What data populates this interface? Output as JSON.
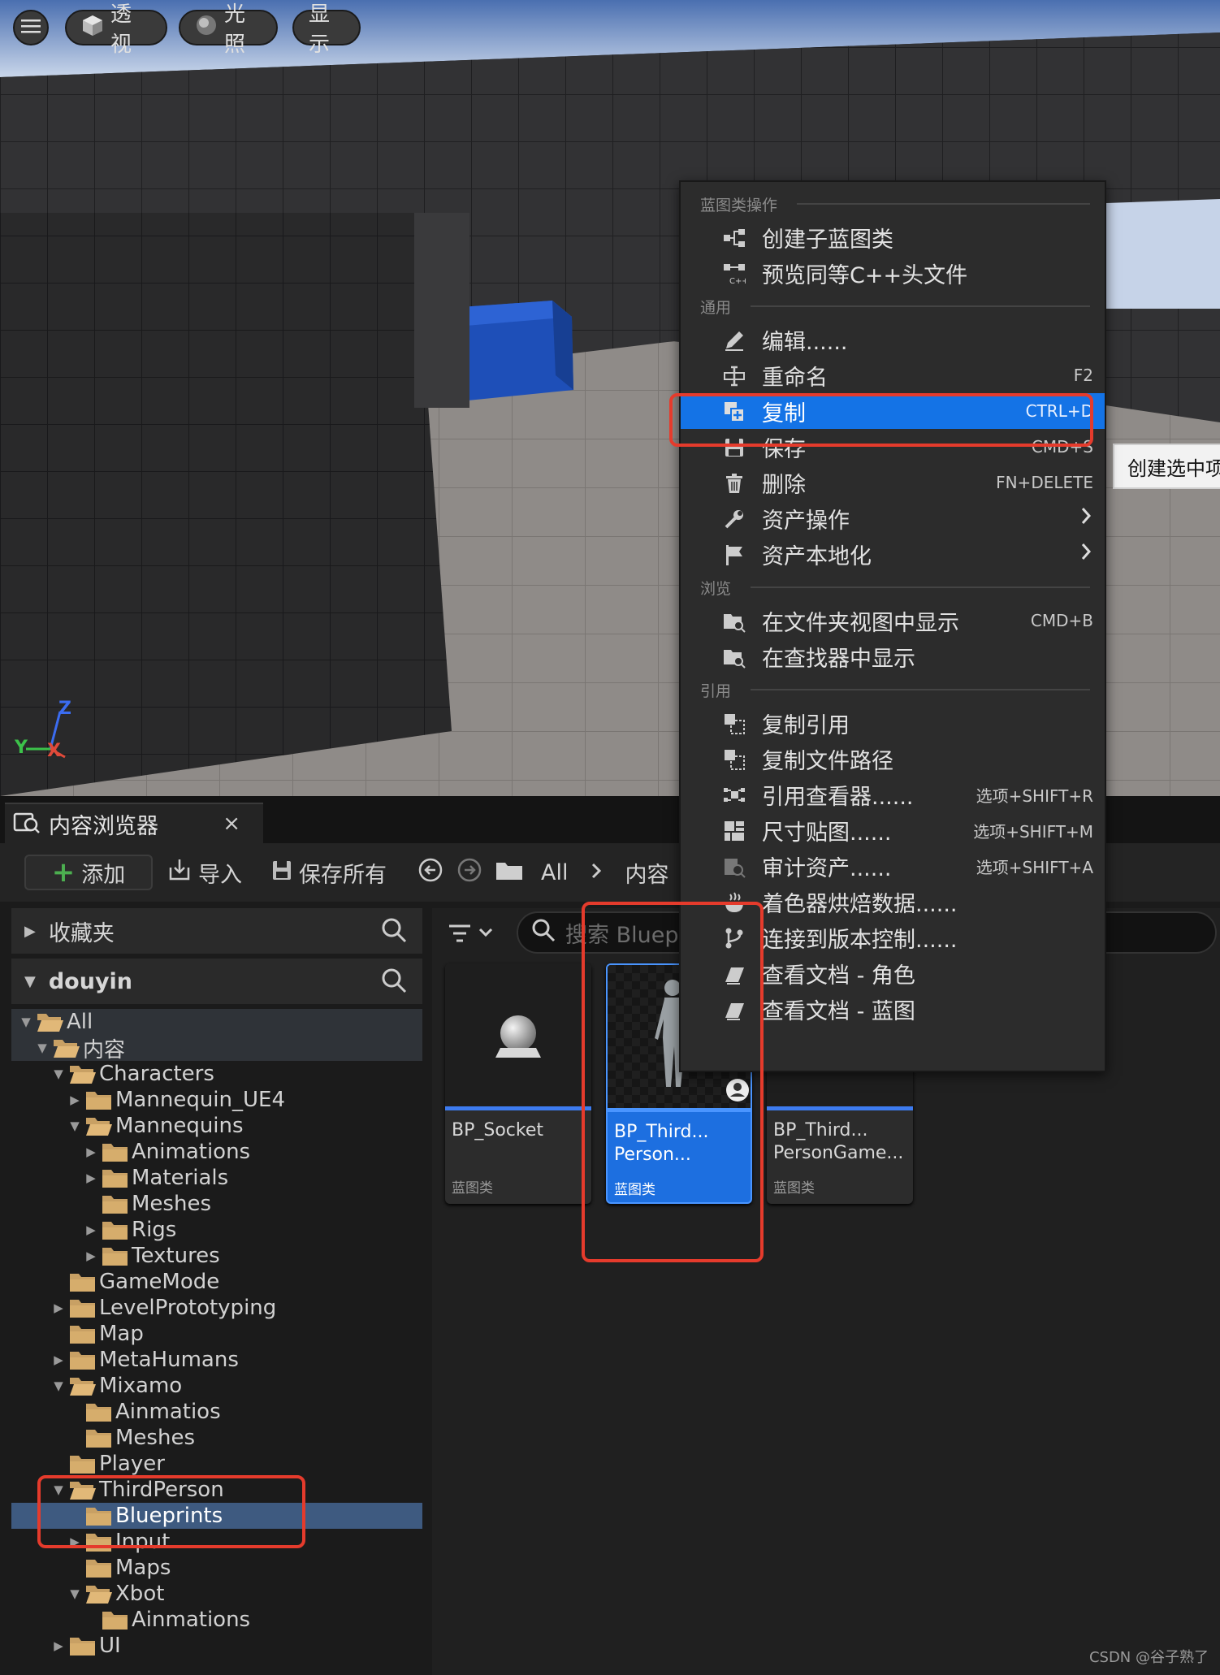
{
  "viewport": {
    "menu_icon": "hamburger-icon",
    "perspective_label": "透视",
    "lighting_label": "光照",
    "show_label": "显示",
    "axis": {
      "z": "Z",
      "y": "Y",
      "x": "X"
    }
  },
  "content_browser": {
    "tab_title": "内容浏览器",
    "tab_close": "×",
    "toolbar": {
      "add_label": "添加",
      "import_label": "导入",
      "save_all_label": "保存所有",
      "breadcrumb": [
        "All",
        "内容"
      ]
    },
    "favorites_label": "收藏夹",
    "project_label": "douyin",
    "search_placeholder": "搜索 Bluepri",
    "tree": [
      {
        "label": "All",
        "depth": 0,
        "expanded": true
      },
      {
        "label": "内容",
        "depth": 1,
        "expanded": true
      },
      {
        "label": "Characters",
        "depth": 2,
        "expanded": true
      },
      {
        "label": "Mannequin_UE4",
        "depth": 3,
        "expanded": false,
        "has_children": true
      },
      {
        "label": "Mannequins",
        "depth": 3,
        "expanded": true
      },
      {
        "label": "Animations",
        "depth": 4,
        "expanded": false,
        "has_children": true
      },
      {
        "label": "Materials",
        "depth": 4,
        "expanded": false,
        "has_children": true
      },
      {
        "label": "Meshes",
        "depth": 4,
        "expanded": false,
        "has_children": false
      },
      {
        "label": "Rigs",
        "depth": 4,
        "expanded": false,
        "has_children": true
      },
      {
        "label": "Textures",
        "depth": 4,
        "expanded": false,
        "has_children": true
      },
      {
        "label": "GameMode",
        "depth": 2,
        "expanded": false,
        "has_children": false
      },
      {
        "label": "LevelPrototyping",
        "depth": 2,
        "expanded": false,
        "has_children": true
      },
      {
        "label": "Map",
        "depth": 2,
        "expanded": false,
        "has_children": false
      },
      {
        "label": "MetaHumans",
        "depth": 2,
        "expanded": false,
        "has_children": true
      },
      {
        "label": "Mixamo",
        "depth": 2,
        "expanded": true
      },
      {
        "label": "Ainmatios",
        "depth": 3,
        "expanded": false,
        "has_children": false
      },
      {
        "label": "Meshes",
        "depth": 3,
        "expanded": false,
        "has_children": false
      },
      {
        "label": "Player",
        "depth": 2,
        "expanded": false,
        "has_children": false
      },
      {
        "label": "ThirdPerson",
        "depth": 2,
        "expanded": true
      },
      {
        "label": "Blueprints",
        "depth": 3,
        "expanded": false,
        "has_children": false,
        "selected": true
      },
      {
        "label": "Input",
        "depth": 3,
        "expanded": false,
        "has_children": true
      },
      {
        "label": "Maps",
        "depth": 3,
        "expanded": false,
        "has_children": false
      },
      {
        "label": "Xbot",
        "depth": 3,
        "expanded": true
      },
      {
        "label": "Ainmations",
        "depth": 4,
        "expanded": false,
        "has_children": false
      },
      {
        "label": "UI",
        "depth": 2,
        "expanded": false,
        "has_children": true
      }
    ],
    "assets": [
      {
        "name": "BP_Socket",
        "type": "蓝图类",
        "selected": false
      },
      {
        "name": "BP_Third...\nPerson...",
        "type": "蓝图类",
        "selected": true
      },
      {
        "name": "BP_Third...\nPersonGame...",
        "type": "蓝图类",
        "selected": false
      }
    ]
  },
  "context_menu": {
    "sections": [
      {
        "title": "蓝图类操作",
        "items": [
          {
            "label": "创建子蓝图类",
            "shortcut": "",
            "icon": "blueprint-child-icon"
          },
          {
            "label": "预览同等C++头文件",
            "shortcut": "",
            "icon": "cpp-header-icon"
          }
        ]
      },
      {
        "title": "通用",
        "items": [
          {
            "label": "编辑......",
            "shortcut": "",
            "icon": "edit-icon"
          },
          {
            "label": "重命名",
            "shortcut": "F2",
            "icon": "rename-icon"
          },
          {
            "label": "复制",
            "shortcut": "CTRL+D",
            "icon": "duplicate-icon",
            "active": true
          },
          {
            "label": "保存",
            "shortcut": "CMD+S",
            "icon": "save-icon"
          },
          {
            "label": "删除",
            "shortcut": "FN+DELETE",
            "icon": "delete-icon"
          },
          {
            "label": "资产操作",
            "shortcut": "",
            "icon": "wrench-icon",
            "submenu": true
          },
          {
            "label": "资产本地化",
            "shortcut": "",
            "icon": "flag-icon",
            "submenu": true
          }
        ]
      },
      {
        "title": "浏览",
        "items": [
          {
            "label": "在文件夹视图中显示",
            "shortcut": "CMD+B",
            "icon": "show-folder-icon"
          },
          {
            "label": "在查找器中显示",
            "shortcut": "",
            "icon": "show-finder-icon"
          }
        ]
      },
      {
        "title": "引用",
        "items": [
          {
            "label": "复制引用",
            "shortcut": "",
            "icon": "copy-reference-icon"
          },
          {
            "label": "复制文件路径",
            "shortcut": "",
            "icon": "copy-path-icon"
          },
          {
            "label": "引用查看器......",
            "shortcut": "选项+SHIFT+R",
            "icon": "reference-viewer-icon"
          },
          {
            "label": "尺寸贴图......",
            "shortcut": "选项+SHIFT+M",
            "icon": "size-map-icon"
          },
          {
            "label": "审计资产......",
            "shortcut": "选项+SHIFT+A",
            "icon": "audit-icon"
          },
          {
            "label": "着色器烘焙数据......",
            "shortcut": "",
            "icon": "shader-icon"
          },
          {
            "label": "连接到版本控制......",
            "shortcut": "",
            "icon": "source-control-icon"
          },
          {
            "label": "查看文档 - 角色",
            "shortcut": "",
            "icon": "docs-icon"
          },
          {
            "label": "查看文档 - 蓝图",
            "shortcut": "",
            "icon": "docs-icon"
          }
        ]
      }
    ]
  },
  "tooltip": "创建选中项",
  "watermark": "CSDN @谷子熟了",
  "colors": {
    "accent": "#1473e6",
    "annotation_red": "#e53b2c",
    "folder": "#c8a064"
  }
}
